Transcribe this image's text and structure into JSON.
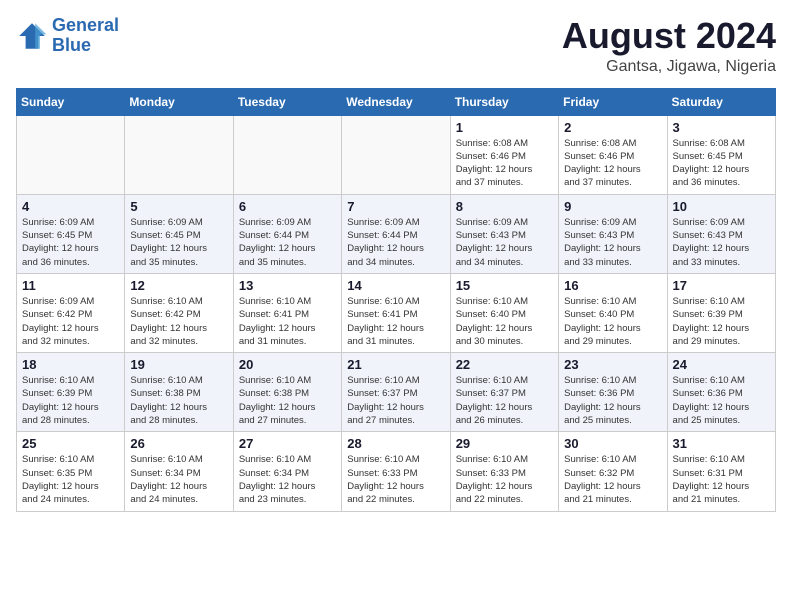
{
  "header": {
    "logo_line1": "General",
    "logo_line2": "Blue",
    "month": "August 2024",
    "location": "Gantsa, Jigawa, Nigeria"
  },
  "weekdays": [
    "Sunday",
    "Monday",
    "Tuesday",
    "Wednesday",
    "Thursday",
    "Friday",
    "Saturday"
  ],
  "weeks": [
    [
      {
        "day": "",
        "info": ""
      },
      {
        "day": "",
        "info": ""
      },
      {
        "day": "",
        "info": ""
      },
      {
        "day": "",
        "info": ""
      },
      {
        "day": "1",
        "info": "Sunrise: 6:08 AM\nSunset: 6:46 PM\nDaylight: 12 hours\nand 37 minutes."
      },
      {
        "day": "2",
        "info": "Sunrise: 6:08 AM\nSunset: 6:46 PM\nDaylight: 12 hours\nand 37 minutes."
      },
      {
        "day": "3",
        "info": "Sunrise: 6:08 AM\nSunset: 6:45 PM\nDaylight: 12 hours\nand 36 minutes."
      }
    ],
    [
      {
        "day": "4",
        "info": "Sunrise: 6:09 AM\nSunset: 6:45 PM\nDaylight: 12 hours\nand 36 minutes."
      },
      {
        "day": "5",
        "info": "Sunrise: 6:09 AM\nSunset: 6:45 PM\nDaylight: 12 hours\nand 35 minutes."
      },
      {
        "day": "6",
        "info": "Sunrise: 6:09 AM\nSunset: 6:44 PM\nDaylight: 12 hours\nand 35 minutes."
      },
      {
        "day": "7",
        "info": "Sunrise: 6:09 AM\nSunset: 6:44 PM\nDaylight: 12 hours\nand 34 minutes."
      },
      {
        "day": "8",
        "info": "Sunrise: 6:09 AM\nSunset: 6:43 PM\nDaylight: 12 hours\nand 34 minutes."
      },
      {
        "day": "9",
        "info": "Sunrise: 6:09 AM\nSunset: 6:43 PM\nDaylight: 12 hours\nand 33 minutes."
      },
      {
        "day": "10",
        "info": "Sunrise: 6:09 AM\nSunset: 6:43 PM\nDaylight: 12 hours\nand 33 minutes."
      }
    ],
    [
      {
        "day": "11",
        "info": "Sunrise: 6:09 AM\nSunset: 6:42 PM\nDaylight: 12 hours\nand 32 minutes."
      },
      {
        "day": "12",
        "info": "Sunrise: 6:10 AM\nSunset: 6:42 PM\nDaylight: 12 hours\nand 32 minutes."
      },
      {
        "day": "13",
        "info": "Sunrise: 6:10 AM\nSunset: 6:41 PM\nDaylight: 12 hours\nand 31 minutes."
      },
      {
        "day": "14",
        "info": "Sunrise: 6:10 AM\nSunset: 6:41 PM\nDaylight: 12 hours\nand 31 minutes."
      },
      {
        "day": "15",
        "info": "Sunrise: 6:10 AM\nSunset: 6:40 PM\nDaylight: 12 hours\nand 30 minutes."
      },
      {
        "day": "16",
        "info": "Sunrise: 6:10 AM\nSunset: 6:40 PM\nDaylight: 12 hours\nand 29 minutes."
      },
      {
        "day": "17",
        "info": "Sunrise: 6:10 AM\nSunset: 6:39 PM\nDaylight: 12 hours\nand 29 minutes."
      }
    ],
    [
      {
        "day": "18",
        "info": "Sunrise: 6:10 AM\nSunset: 6:39 PM\nDaylight: 12 hours\nand 28 minutes."
      },
      {
        "day": "19",
        "info": "Sunrise: 6:10 AM\nSunset: 6:38 PM\nDaylight: 12 hours\nand 28 minutes."
      },
      {
        "day": "20",
        "info": "Sunrise: 6:10 AM\nSunset: 6:38 PM\nDaylight: 12 hours\nand 27 minutes."
      },
      {
        "day": "21",
        "info": "Sunrise: 6:10 AM\nSunset: 6:37 PM\nDaylight: 12 hours\nand 27 minutes."
      },
      {
        "day": "22",
        "info": "Sunrise: 6:10 AM\nSunset: 6:37 PM\nDaylight: 12 hours\nand 26 minutes."
      },
      {
        "day": "23",
        "info": "Sunrise: 6:10 AM\nSunset: 6:36 PM\nDaylight: 12 hours\nand 25 minutes."
      },
      {
        "day": "24",
        "info": "Sunrise: 6:10 AM\nSunset: 6:36 PM\nDaylight: 12 hours\nand 25 minutes."
      }
    ],
    [
      {
        "day": "25",
        "info": "Sunrise: 6:10 AM\nSunset: 6:35 PM\nDaylight: 12 hours\nand 24 minutes."
      },
      {
        "day": "26",
        "info": "Sunrise: 6:10 AM\nSunset: 6:34 PM\nDaylight: 12 hours\nand 24 minutes."
      },
      {
        "day": "27",
        "info": "Sunrise: 6:10 AM\nSunset: 6:34 PM\nDaylight: 12 hours\nand 23 minutes."
      },
      {
        "day": "28",
        "info": "Sunrise: 6:10 AM\nSunset: 6:33 PM\nDaylight: 12 hours\nand 22 minutes."
      },
      {
        "day": "29",
        "info": "Sunrise: 6:10 AM\nSunset: 6:33 PM\nDaylight: 12 hours\nand 22 minutes."
      },
      {
        "day": "30",
        "info": "Sunrise: 6:10 AM\nSunset: 6:32 PM\nDaylight: 12 hours\nand 21 minutes."
      },
      {
        "day": "31",
        "info": "Sunrise: 6:10 AM\nSunset: 6:31 PM\nDaylight: 12 hours\nand 21 minutes."
      }
    ]
  ]
}
